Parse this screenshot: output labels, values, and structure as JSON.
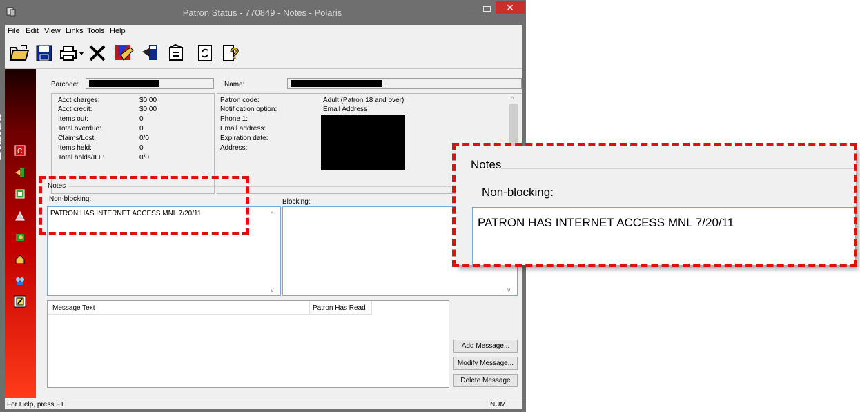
{
  "window": {
    "title": "Patron Status - 770849 - Notes - Polaris",
    "controls": {
      "minimize": "–",
      "close": "✕"
    }
  },
  "menu": [
    "File",
    "Edit",
    "View",
    "Links",
    "Tools",
    "Help"
  ],
  "toolbar_icons": [
    "open-folder-icon",
    "save-icon",
    "print-icon",
    "delete-icon",
    "check-in-icon",
    "check-out-icon",
    "properties-icon",
    "refresh-icon",
    "help-icon"
  ],
  "sidebar": {
    "status_label": "Status",
    "icons": [
      "charges-icon",
      "items-out-icon",
      "holds-icon",
      "ill-icon",
      "claims-icon",
      "address-icon",
      "associations-icon",
      "notes-icon"
    ]
  },
  "patron": {
    "barcode_label": "Barcode:",
    "name_label": "Name:",
    "acct_rows": [
      {
        "label": "Acct charges:",
        "value": "$0.00"
      },
      {
        "label": "Acct credit:",
        "value": "$0.00"
      },
      {
        "label": "Items out:",
        "value": "0"
      },
      {
        "label": "Total overdue:",
        "value": "0"
      },
      {
        "label": "Claims/Lost:",
        "value": "0/0"
      },
      {
        "label": "Items held:",
        "value": "0"
      },
      {
        "label": "Total holds/ILL:",
        "value": "0/0"
      }
    ],
    "info_rows": [
      {
        "label": "Patron code:",
        "value": "Adult (Patron 18 and over)"
      },
      {
        "label": "Notification option:",
        "value": "Email Address"
      },
      {
        "label": "Phone 1:",
        "value": ""
      },
      {
        "label": "Email address:",
        "value": ""
      },
      {
        "label": "Expiration date:",
        "value": ""
      },
      {
        "label": "Address:",
        "value": ""
      }
    ]
  },
  "notes": {
    "section_label": "Notes",
    "non_blocking_label": "Non-blocking:",
    "non_blocking_text": "PATRON HAS INTERNET ACCESS MNL 7/20/11",
    "blocking_label": "Blocking:"
  },
  "messages": {
    "columns": [
      "Message Text",
      "Patron Has Read"
    ],
    "buttons": {
      "add": "Add Message...",
      "modify": "Modify Message...",
      "delete": "Delete Message"
    }
  },
  "statusbar": {
    "help": "For Help, press F1",
    "num": "NUM"
  },
  "zoom_callout": {
    "section_label": "Notes",
    "non_blocking_label": "Non-blocking:",
    "text": "PATRON HAS INTERNET ACCESS MNL 7/20/11"
  },
  "colors": {
    "highlight": "#e01010",
    "sidebar_red": "#c40000",
    "close_red": "#c9302c"
  }
}
